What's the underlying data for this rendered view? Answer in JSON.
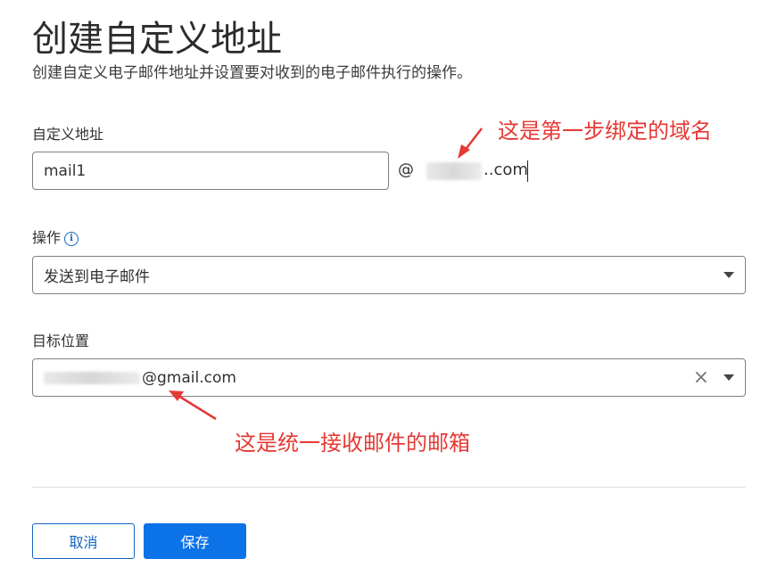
{
  "page": {
    "title": "创建自定义地址",
    "subtitle": "创建自定义电子邮件地址并设置要对收到的电子邮件执行的操作。"
  },
  "custom_address": {
    "label": "自定义地址",
    "value": "mail1",
    "at": "@",
    "domain_suffix": "..com"
  },
  "action": {
    "label": "操作",
    "info_glyph": "i",
    "selected": "发送到电子邮件"
  },
  "destination": {
    "label": "目标位置",
    "value_suffix": "@gmail.com",
    "clear_glyph": "×"
  },
  "buttons": {
    "cancel": "取消",
    "save": "保存"
  },
  "annotations": {
    "domain_note": "这是第一步绑定的域名",
    "inbox_note": "这是统一接收邮件的邮箱",
    "color": "#e53935"
  },
  "colors": {
    "primary": "#0b72e7",
    "link": "#1565c0"
  },
  "icons": [
    "info-icon",
    "chevron-down-icon",
    "close-icon",
    "arrow-icon"
  ]
}
